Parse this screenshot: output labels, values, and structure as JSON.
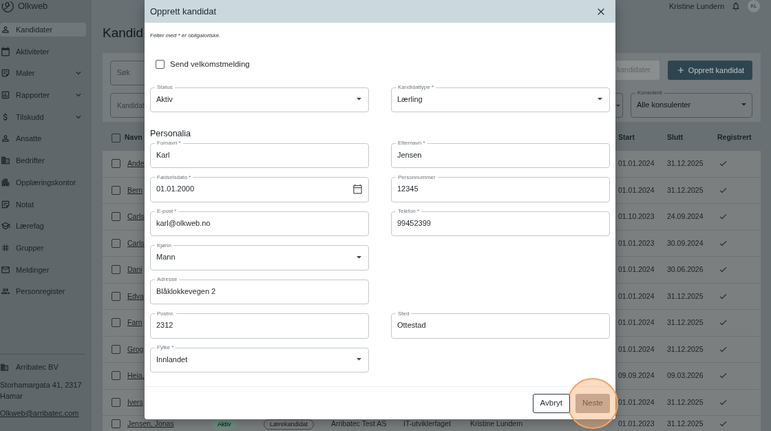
{
  "sidebar": {
    "logo": "Olkweb",
    "items": [
      {
        "label": "Kandidater",
        "selected": true,
        "expandable": false
      },
      {
        "label": "Aktiviteter",
        "selected": false,
        "expandable": false
      },
      {
        "label": "Maler",
        "selected": false,
        "expandable": true
      },
      {
        "label": "Rapporter",
        "selected": false,
        "expandable": true
      },
      {
        "label": "Tilskudd",
        "selected": false,
        "expandable": true
      },
      {
        "label": "Ansatte",
        "selected": false,
        "expandable": false
      },
      {
        "label": "Bedrifter",
        "selected": false,
        "expandable": false
      },
      {
        "label": "Opplæringskontor",
        "selected": false,
        "expandable": false
      },
      {
        "label": "Notat",
        "selected": false,
        "expandable": false
      },
      {
        "label": "Lærefag",
        "selected": false,
        "expandable": false
      },
      {
        "label": "Grupper",
        "selected": false,
        "expandable": false
      },
      {
        "label": "Meldinger",
        "selected": false,
        "expandable": false
      },
      {
        "label": "Personregister",
        "selected": false,
        "expandable": false
      }
    ],
    "organization": {
      "name": "Arribatec BV",
      "address": "Storhamargata 41, 2317 Hamar",
      "email": "Olkweb@arribatec.com"
    }
  },
  "top_bar": {
    "user_name": "Kristine Lundern",
    "avatar_initials": "KL"
  },
  "page": {
    "title": "Kandid",
    "search": {
      "placeholder": "Søk"
    },
    "type_filter": {
      "placeholder": "Kandidat"
    },
    "buttons": [
      {
        "label": "kandidater",
        "kind": "secondary"
      },
      {
        "label": "Opprett kandidat",
        "kind": "primary"
      }
    ],
    "consultant_filter": {
      "label": "Konsulent",
      "value": "Alle konsulenter"
    }
  },
  "table": {
    "select_all_checked": false,
    "columns": {
      "name": "Navn",
      "start": "Start",
      "end": "Slutt",
      "registered": "Registrert"
    },
    "rows": [
      {
        "checked": false,
        "name": "Ande",
        "start": "01.01.2024",
        "end": "31.12.2025",
        "registered": true
      },
      {
        "checked": false,
        "name": "Bern",
        "start": "01.01.2024",
        "end": "31.12.2025",
        "registered": true
      },
      {
        "checked": false,
        "name": "Carls",
        "start": "01.10.2023",
        "end": "24.09.2024",
        "registered": true
      },
      {
        "checked": false,
        "name": "Carls",
        "start": "01.01.2023",
        "end": "30.09.2024",
        "registered": true
      },
      {
        "checked": false,
        "name": "Dani",
        "start": "01.01.2024",
        "end": "30.06.2026",
        "registered": true
      },
      {
        "checked": false,
        "name": "Edva",
        "start": "01.01.2024",
        "end": "31.12.2025",
        "registered": true
      },
      {
        "checked": false,
        "name": "Farn",
        "start": "01.01.2024",
        "end": "31.12.2025",
        "registered": true
      },
      {
        "checked": false,
        "name": "Grog",
        "start": "01.01.2024",
        "end": "31.12.2025",
        "registered": true
      },
      {
        "checked": false,
        "name": "Heia,",
        "start": "09.09.2024",
        "end": "09.03.2026",
        "registered": true
      },
      {
        "checked": false,
        "name": "Ivers",
        "start": "01.01.2024",
        "end": "31.12.2025",
        "registered": true
      },
      {
        "checked": false,
        "name": "Jensen, Jonas",
        "status": "Aktiv",
        "type": "Lærekandidat",
        "company": "Arribatec Test AS",
        "trade": "IT-utviklerfaget",
        "consultant": "Kristine Lundern",
        "start": "01.01.2023",
        "end": "31.12.2025",
        "registered": true
      }
    ]
  },
  "dialog": {
    "title": "Opprett kandidat",
    "note": "Felter med * er obligatoriske.",
    "welcome_message": {
      "label": "Send velkomstmelding",
      "checked": false
    },
    "top_fields": [
      {
        "kind": "select",
        "label": "Status",
        "value": "Aktiv"
      },
      {
        "kind": "select",
        "label": "Kandidattype *",
        "value": "Lærling"
      }
    ],
    "section": {
      "title": "Personalia",
      "rows": [
        [
          {
            "kind": "text",
            "label": "Fornavn *",
            "value": "Karl"
          },
          {
            "kind": "text",
            "label": "Etternavn *",
            "value": "Jensen"
          }
        ],
        [
          {
            "kind": "date",
            "label": "Fødselsdato *",
            "value": "01.01.2000"
          },
          {
            "kind": "text",
            "label": "Personnummer",
            "value": "12345"
          }
        ],
        [
          {
            "kind": "text",
            "label": "E-post *",
            "value": "karl@olkweb.no"
          },
          {
            "kind": "text",
            "label": "Telefon *",
            "value": "99452399"
          }
        ],
        [
          {
            "kind": "select",
            "label": "Kjønn",
            "value": "Mann"
          }
        ],
        [
          {
            "kind": "text",
            "label": "Adresse",
            "value": "Blåklokkevegen 2"
          }
        ],
        [
          {
            "kind": "text",
            "label": "Postnr.",
            "value": "2312"
          },
          {
            "kind": "text",
            "label": "Sted",
            "value": "Ottestad"
          }
        ],
        [
          {
            "kind": "select",
            "label": "Fylke *",
            "value": "Innlandet"
          }
        ]
      ]
    },
    "buttons": [
      {
        "label": "Avbryt",
        "kind": "secondary",
        "disabled": false,
        "highlighted": false
      },
      {
        "label": "Neste",
        "kind": "primary",
        "disabled": true,
        "highlighted": true
      }
    ]
  }
}
